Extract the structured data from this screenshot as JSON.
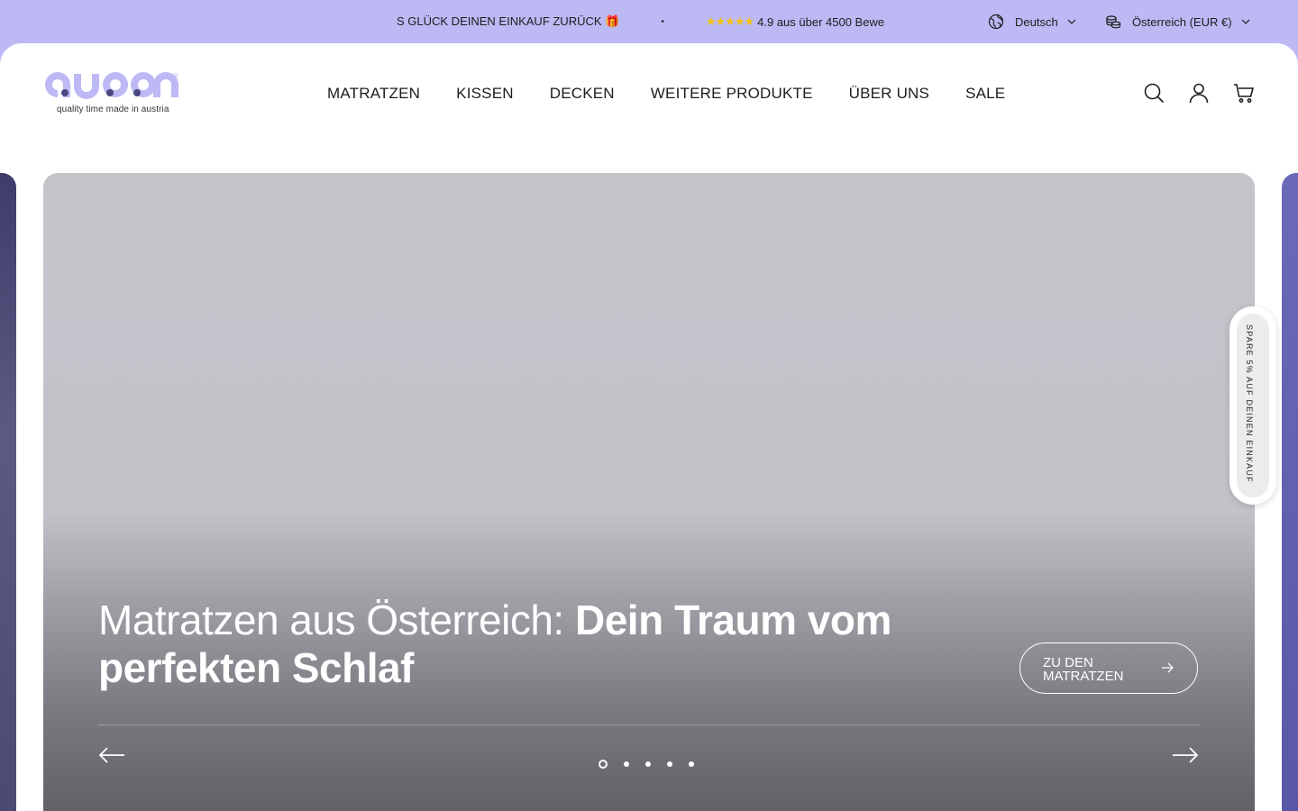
{
  "announcement": {
    "ticker_1": "S GLÜCK DEINEN EINKAUF ZURÜCK 🎁",
    "separator": "•",
    "stars": "★★★★★",
    "ticker_2": "4.9 aus über 4500 Bewe",
    "language": "Deutsch",
    "country": "Österreich (EUR €)"
  },
  "brand": {
    "tagline": "quality time made in austria",
    "color": "#bdb9f5",
    "accent_dot": "#4a4880"
  },
  "nav": {
    "items": [
      "MATRATZEN",
      "KISSEN",
      "DECKEN",
      "WEITERE PRODUKTE",
      "ÜBER UNS",
      "SALE"
    ]
  },
  "header_icons": [
    "search-icon",
    "account-icon",
    "cart-icon"
  ],
  "hero": {
    "headline_light": "Matratzen aus Österreich: ",
    "headline_bold": "Dein Traum vom perfekten Schlaf",
    "cta_label": "ZU DEN MATRATZEN",
    "slides_total": 5,
    "active_slide": 1
  },
  "promo_tab": {
    "label": "SPARE 5% AUF DEINEN EINKAUF"
  }
}
